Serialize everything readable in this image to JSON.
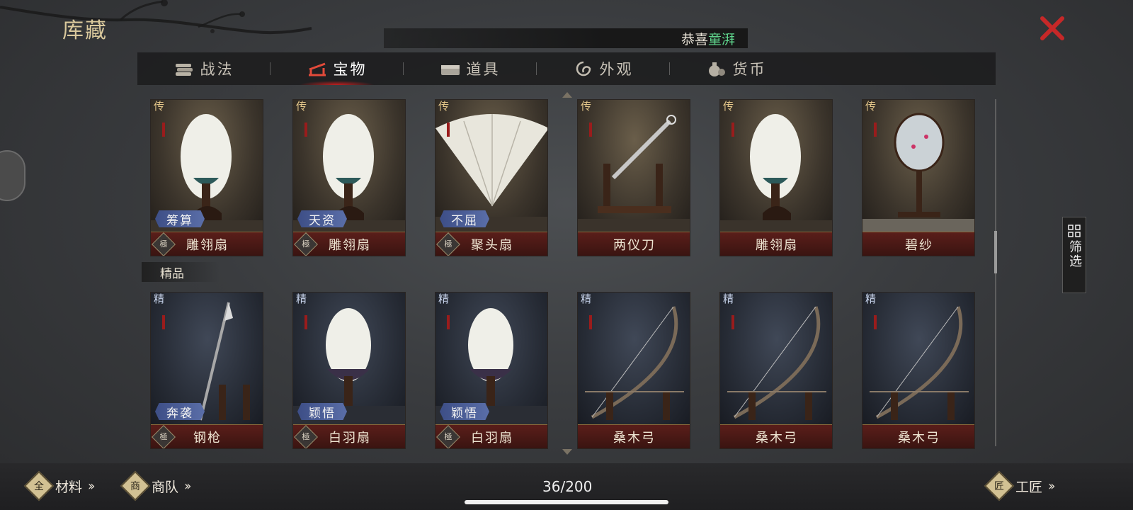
{
  "header": {
    "title": "库藏"
  },
  "notice": {
    "prefix": "恭喜",
    "name": "童湃"
  },
  "tabs": [
    {
      "label": "战法",
      "icon": "scroll-bundle-icon",
      "active": false
    },
    {
      "label": "宝物",
      "icon": "weapon-rack-icon",
      "active": true
    },
    {
      "label": "道具",
      "icon": "chest-icon",
      "active": false
    },
    {
      "label": "外观",
      "icon": "swirl-icon",
      "active": false
    },
    {
      "label": "货币",
      "icon": "money-bag-icon",
      "active": false
    }
  ],
  "sections": {
    "fine_label": "精品"
  },
  "premium_items": [
    {
      "rank": "传",
      "tag": "筹算",
      "name": "雕翎扇",
      "grade": "極",
      "art": "feather-fan"
    },
    {
      "rank": "传",
      "tag": "天资",
      "name": "雕翎扇",
      "grade": "極",
      "art": "feather-fan"
    },
    {
      "rank": "传",
      "tag": "不屈",
      "name": "聚头扇",
      "grade": "極",
      "art": "folding-fan"
    },
    {
      "rank": "传",
      "tag": "",
      "name": "两仪刀",
      "grade": "",
      "art": "sword"
    },
    {
      "rank": "传",
      "tag": "",
      "name": "雕翎扇",
      "grade": "",
      "art": "feather-fan"
    },
    {
      "rank": "传",
      "tag": "",
      "name": "碧纱",
      "grade": "",
      "art": "screen-fan"
    }
  ],
  "fine_items": [
    {
      "rank": "精",
      "tag": "奔袭",
      "name": "钢枪",
      "grade": "極",
      "art": "spear"
    },
    {
      "rank": "精",
      "tag": "颖悟",
      "name": "白羽扇",
      "grade": "極",
      "art": "white-fan"
    },
    {
      "rank": "精",
      "tag": "颖悟",
      "name": "白羽扇",
      "grade": "極",
      "art": "white-fan"
    },
    {
      "rank": "精",
      "tag": "",
      "name": "桑木弓",
      "grade": "",
      "art": "bow"
    },
    {
      "rank": "精",
      "tag": "",
      "name": "桑木弓",
      "grade": "",
      "art": "bow"
    },
    {
      "rank": "精",
      "tag": "",
      "name": "桑木弓",
      "grade": "",
      "art": "bow"
    }
  ],
  "filter": {
    "label": "筛选"
  },
  "bottom": {
    "materials": {
      "label": "材料",
      "icon_char": "全"
    },
    "caravan": {
      "label": "商队",
      "icon_char": "商"
    },
    "counter": "36/200",
    "craftsman": {
      "label": "工匠",
      "icon_char": "匠"
    }
  },
  "colors": {
    "accent_red": "#c21f1f",
    "highlight_green": "#5fd48c",
    "title_gold": "#d9c89c",
    "tag_blue": "#4a5d97"
  }
}
